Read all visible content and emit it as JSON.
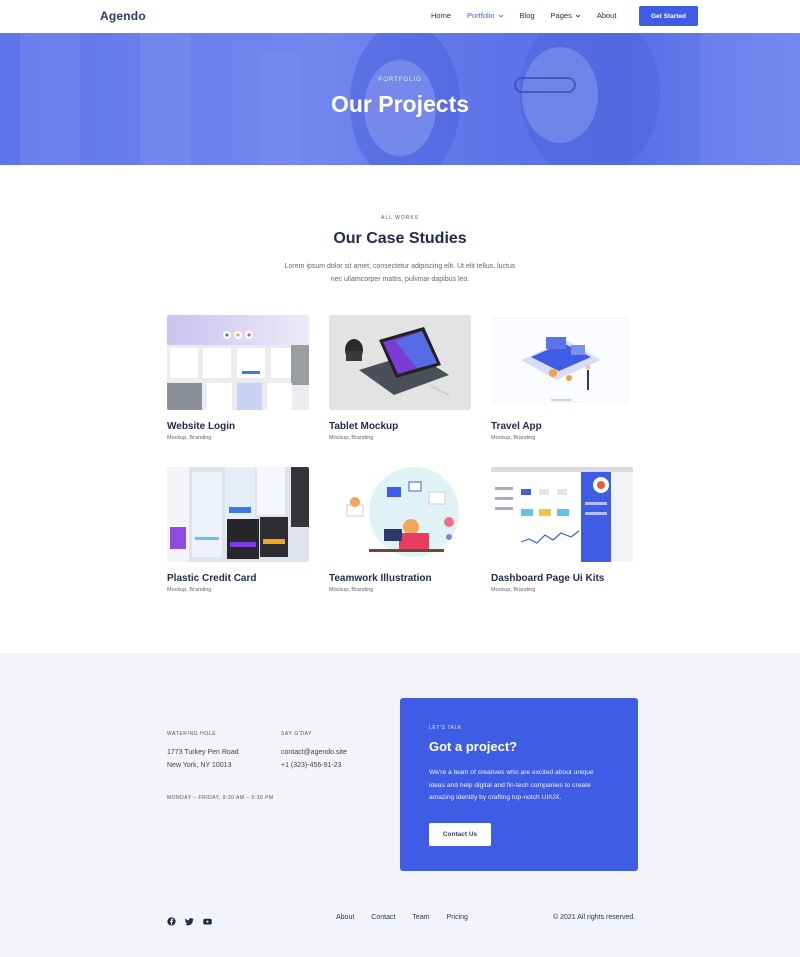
{
  "brand": {
    "logo": "Agendo",
    "accent": "#3f5de4"
  },
  "nav": {
    "items": [
      {
        "label": "Home",
        "active": false,
        "dropdown": false
      },
      {
        "label": "Portfolio",
        "active": true,
        "dropdown": true
      },
      {
        "label": "Blog",
        "active": false,
        "dropdown": false
      },
      {
        "label": "Pages",
        "active": false,
        "dropdown": true
      },
      {
        "label": "About",
        "active": false,
        "dropdown": false
      }
    ],
    "cta_label": "Get Started"
  },
  "hero": {
    "kicker": "PORTFOLIO",
    "title": "Our Projects"
  },
  "works": {
    "kicker": "ALL WORKS",
    "title": "Our Case Studies",
    "description": "Lorem ipsum dolor sit amet, consectetur adipiscing elit. Ut elit tellus, luctus nec ullamcorper mattis, pulvinar dapibus leo.",
    "projects": [
      {
        "title": "Website Login",
        "tags": "Mockup, Branding"
      },
      {
        "title": "Tablet Mockup",
        "tags": "Mockup, Branding"
      },
      {
        "title": "Travel App",
        "tags": "Mockup, Branding"
      },
      {
        "title": "Plastic Credit Card",
        "tags": "Mockup, Branding"
      },
      {
        "title": "Teamwork Illustration",
        "tags": "Mockup, Branding"
      },
      {
        "title": "Dashboard Page Ui Kits",
        "tags": "Mockup, Branding"
      }
    ]
  },
  "contact": {
    "watering_hole": {
      "kicker": "WATERING HOLE",
      "line1": "1773 Turkey Pen Road",
      "line2": "New York, NY 10013"
    },
    "say_gday": {
      "kicker": "SAY G'DAY",
      "email": "contact@agendo.site",
      "phone": "+1 (323)-456-91-23"
    },
    "hours": "MONDAY – FRIDAY, 9:30 AM – 5:30 PM",
    "cta": {
      "kicker": "LET'S TALK",
      "title": "Got a project?",
      "text": "We're a team of creatives who are excited about unique ideas and help digital and fin-tech companies to create amazing identity by crafting top-notch UI/UX.",
      "button_label": "Contact Us"
    }
  },
  "footer": {
    "social_icons": [
      "facebook-icon",
      "twitter-icon",
      "youtube-icon"
    ],
    "links": [
      "About",
      "Contact",
      "Team",
      "Pricing"
    ],
    "copyright": "© 2021 All rights reserved."
  }
}
